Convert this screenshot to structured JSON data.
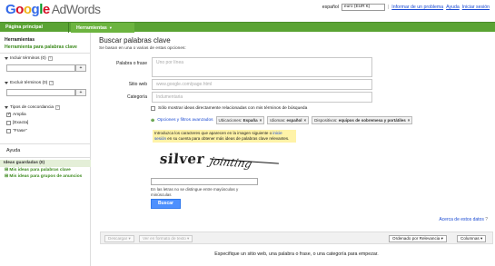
{
  "header": {
    "logo_google": "Google",
    "logo_product": "AdWords",
    "language": "español",
    "currency": "euro (EUR €)",
    "links": [
      "Informar de un problema",
      "Ayuda",
      "Iniciar sesión"
    ],
    "separator": "|"
  },
  "nav": {
    "tabs": [
      {
        "label": "Página principal"
      },
      {
        "label": "Herramientas"
      }
    ]
  },
  "sidebar": {
    "title": "Herramientas",
    "current_tool": "Herramienta para palabras clave",
    "include_label": "Incluir términos (0)",
    "exclude_label": "Excluir términos (0)",
    "plus": "+",
    "help_glyph": "?",
    "match_types_label": "Tipos de concordancia",
    "match_types": [
      {
        "label": "Amplia",
        "checked": true
      },
      {
        "label": "[Exacta]",
        "checked": false
      },
      {
        "label": "\"Frase\"",
        "checked": false
      }
    ],
    "help_heading": "Ayuda",
    "saved_ideas": "Ideas guardadas (0)",
    "saved_links": [
      "Mis ideas para palabras clave",
      "Mis ideas para grupos de anuncios"
    ]
  },
  "main": {
    "title": "Buscar palabras clave",
    "subtitle": "Se basan en una o varias de estas opciones:",
    "fields": [
      {
        "label": "Palabra o frase",
        "placeholder": "Uno por línea"
      },
      {
        "label": "Sitio web",
        "placeholder": "www.google.com/page.html"
      },
      {
        "label": "Categoría",
        "placeholder": "Indumentaria"
      }
    ],
    "only_related_checkbox": "Sólo mostrar ideas directamente relacionadas con mis términos de búsqueda",
    "filters_link": "Opciones y filtros avanzados",
    "filter_chips": [
      {
        "key": "Ubicaciones:",
        "value": "España"
      },
      {
        "key": "Idiomas:",
        "value": "español"
      },
      {
        "key": "Dispositivos:",
        "value": "equipos de sobremesa y portátiles"
      }
    ],
    "captcha_note_before": "Introduzca los caracteres que aparecen en la imagen siguiente o ",
    "captcha_note_link": "inicie sesión",
    "captcha_note_after": " en su cuenta para obtener más ideas de palabras clave relevantes.",
    "captcha_word1": "silver",
    "captcha_word2": "jointing",
    "captcha_hint": "En las letras no se distingue entre mayúsculas y minúsculas",
    "search_button": "Buscar",
    "about_link": "Acerca de estos datos"
  },
  "results": {
    "toolbar": {
      "download": "Descargar",
      "view_as_text": "Ver en formato de texto",
      "sort": "Ordenado por Relevancia",
      "columns": "Columnas"
    },
    "empty_message": "Especifique un sitio web, una palabra o frase, o una categoría para empezar."
  }
}
